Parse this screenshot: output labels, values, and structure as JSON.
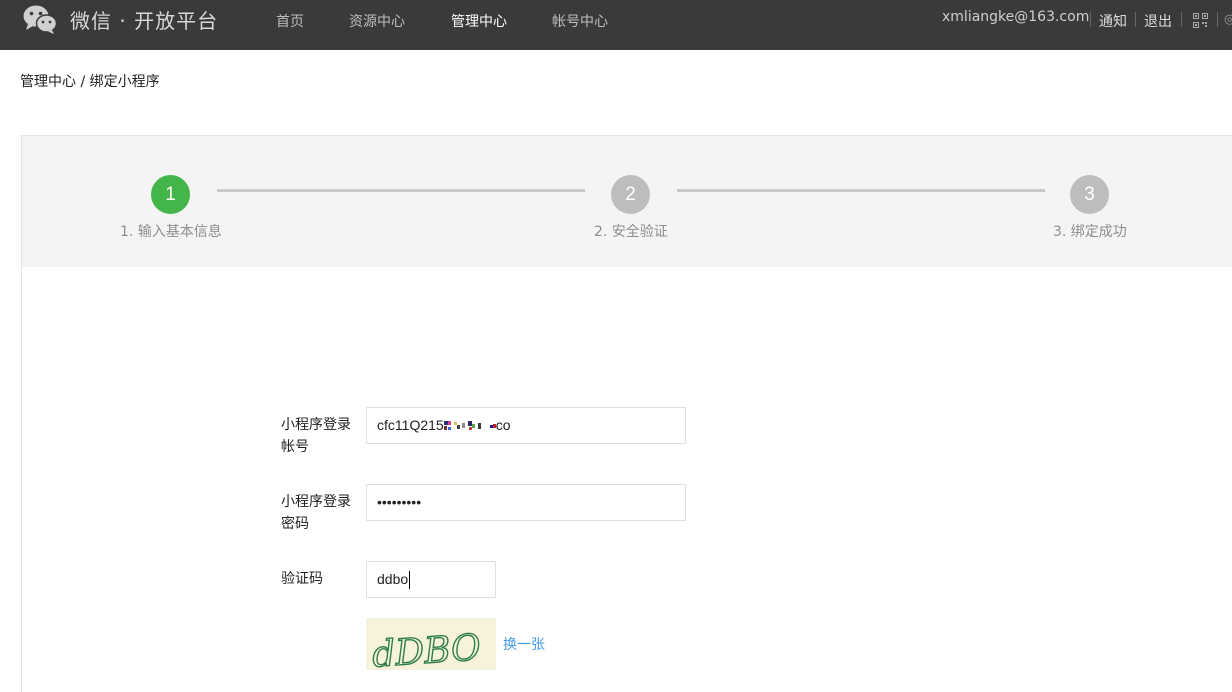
{
  "header": {
    "brand": "微信 · 开放平台",
    "nav": [
      {
        "label": "首页",
        "active": false
      },
      {
        "label": "资源中心",
        "active": false
      },
      {
        "label": "管理中心",
        "active": true
      },
      {
        "label": "帐号中心",
        "active": false
      }
    ],
    "user_email": "xmliangke@163.com",
    "notify_label": "通知",
    "logout_label": "退出"
  },
  "breadcrumb": "管理中心 / 绑定小程序",
  "steps": [
    {
      "number": "1",
      "label": "1. 输入基本信息",
      "status": "done"
    },
    {
      "number": "2",
      "label": "2. 安全验证",
      "status": "pending"
    },
    {
      "number": "3",
      "label": "3. 绑定成功",
      "status": "pending"
    }
  ],
  "form": {
    "account_label_line1": "小程序登录",
    "account_label_line2": "帐号",
    "account_value_prefix": "cfc11",
    "account_value_mid": "Q215",
    "account_value_suffix": "co",
    "password_label_line1": "小程序登录",
    "password_label_line2": "密码",
    "password_value": "•••••••••",
    "captcha_label": "验证码",
    "captcha_value": "ddbo",
    "captcha_image_text": "dDBO",
    "refresh_label": "换一张"
  },
  "colors": {
    "topbar": "#3a3a3a",
    "step_done": "#44b549",
    "step_pending": "#bdbdbd",
    "link": "#459ae9"
  }
}
